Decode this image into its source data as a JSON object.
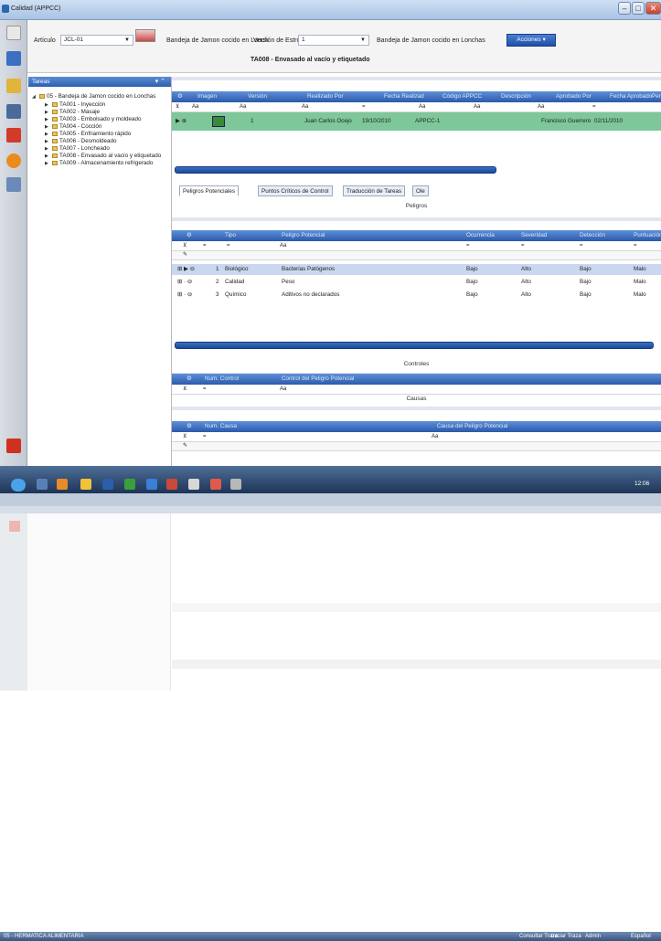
{
  "window": {
    "title": "Calidad (APPCC)",
    "controls": {
      "minimize": "–",
      "maximize": "□",
      "close": "✕"
    }
  },
  "header": {
    "articulo_label": "Artículo",
    "articulo_value": "JCL-01",
    "product_name": "Bandeja de Jamon cocido en Lonch",
    "version_label": "Versión de Estruct:",
    "version_value": "1",
    "structure_value": "Bandeja de Jamon cocido en Lonchas",
    "actions_button": "Acciones",
    "task_title": "TA008 - Envasado al vacío y etiquetado"
  },
  "tree": {
    "title": "Tareas",
    "root": "05 - Bandeja de Jamon cocido en Lonchas",
    "items": [
      "TA001 - Inyección",
      "TA002 - Masaje",
      "TA003 - Embolsado y moldeado",
      "TA004 - Cocción",
      "TA005 - Enfriamiento rápido",
      "TA006 - Desmoldeado",
      "TA007 - Loncheado",
      "TA008 - Envasado al vacío y etiquetado",
      "TA009 - Almacenamiento refrigerado"
    ]
  },
  "task_grid": {
    "columns": [
      "Imagen",
      "Versión",
      "Realizado Por",
      "Fecha Realizad",
      "Código APPCC",
      "Descripción",
      "Aprobado Por",
      "Fecha Aprobado",
      "Pendiente"
    ],
    "filter_symbols": [
      "Aa",
      "Aa",
      "Aa",
      "=",
      "Aa",
      "Aa",
      "Aa",
      "="
    ],
    "row": {
      "version": "1",
      "realizado_por": "Juan Carlos Ocejo",
      "fecha_realizado": "19/10/2010",
      "codigo": "APPCC-1",
      "aprobado_por": "Francisco Guerrero",
      "fecha_aprobado": "02/11/2010"
    }
  },
  "tabs": [
    "Peligros Potenciales",
    "Puntos Críticos de Control",
    "Traducción de Tareas",
    "Ole"
  ],
  "peligros": {
    "title": "Peligros",
    "columns": [
      "Tipo",
      "Peligro Potencial",
      "Ocurrencia",
      "Severidad",
      "Detección",
      "Puntuación"
    ],
    "rows": [
      {
        "num": "1",
        "tipo": "Biológico",
        "peligro": "Bacterias Patógenos",
        "ocurrencia": "Bajo",
        "severidad": "Alto",
        "deteccion": "Bajo",
        "puntuacion": "Malo"
      },
      {
        "num": "2",
        "tipo": "Calidad",
        "peligro": "Peso",
        "ocurrencia": "Bajo",
        "severidad": "Alto",
        "deteccion": "Bajo",
        "puntuacion": "Malo"
      },
      {
        "num": "3",
        "tipo": "Químico",
        "peligro": "Aditivos no declarados",
        "ocurrencia": "Bajo",
        "severidad": "Alto",
        "deteccion": "Bajo",
        "puntuacion": "Malo"
      }
    ]
  },
  "controles": {
    "title": "Controles",
    "columns": [
      "Num. Control",
      "Control del Peligro Potencial"
    ]
  },
  "causas": {
    "title": "Causas",
    "columns": [
      "Num. Causa",
      "Causa del Peligro Potencial"
    ]
  },
  "taskbar": {
    "label": "05 - HERMATICA ALIMENTARIA",
    "consultar": "Consultar Traza",
    "iniciar": "Iniciar Traza",
    "admin": "Admin",
    "language": "Español",
    "time": "12:06"
  },
  "colors": {
    "accent": "#2b5aaa",
    "selected_row": "#7dc79a",
    "row_highlight": "#c9d8f0"
  }
}
